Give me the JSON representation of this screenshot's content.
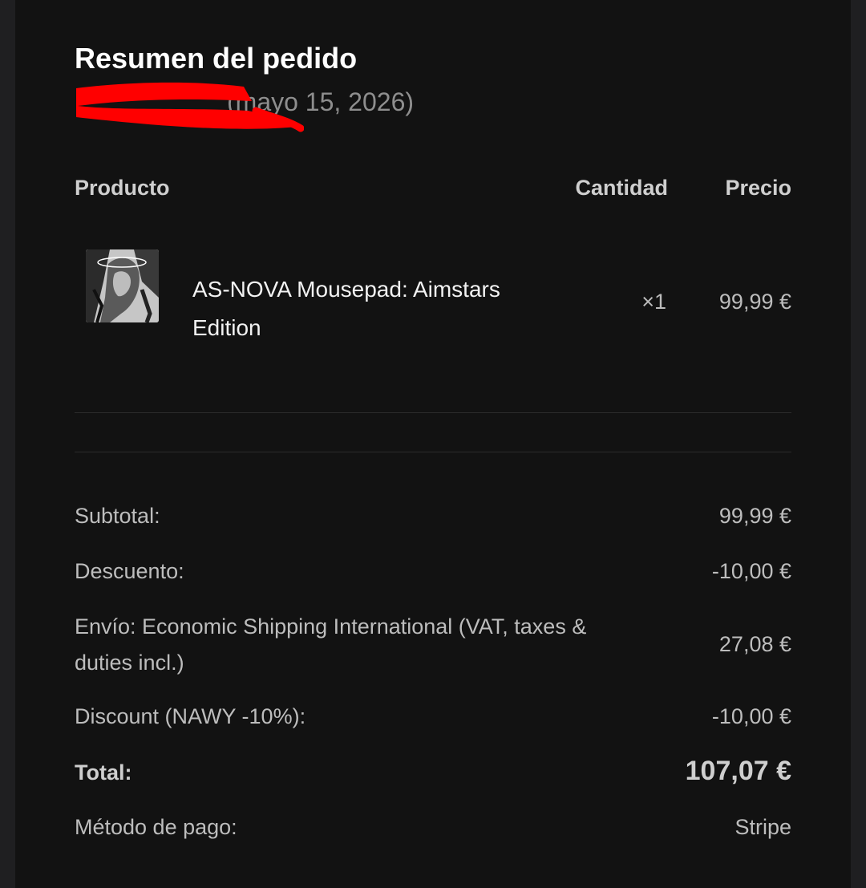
{
  "summary": {
    "title": "Resumen del pedido",
    "order_date": "(mayo 15, 2026)"
  },
  "columns": {
    "product": "Producto",
    "quantity": "Cantidad",
    "price": "Precio"
  },
  "items": [
    {
      "name": "AS-NOVA Mousepad: Aimstars Edition",
      "quantity": "×1",
      "price": "99,99 €"
    }
  ],
  "totals": {
    "subtotal_label": "Subtotal:",
    "subtotal_value": "99,99 €",
    "discount_label": "Descuento:",
    "discount_value": "-10,00 €",
    "shipping_label": "Envío: Economic Shipping International (VAT, taxes & duties incl.)",
    "shipping_value": "27,08 €",
    "coupon_label": "Discount (NAWY -10%):",
    "coupon_value": "-10,00 €",
    "total_label": "Total:",
    "total_value": "107,07 €",
    "payment_label": "Método de pago:",
    "payment_value": "Stripe"
  },
  "colors": {
    "background": "#121212",
    "outer": "#1f1f21",
    "redaction": "#ff0000"
  }
}
